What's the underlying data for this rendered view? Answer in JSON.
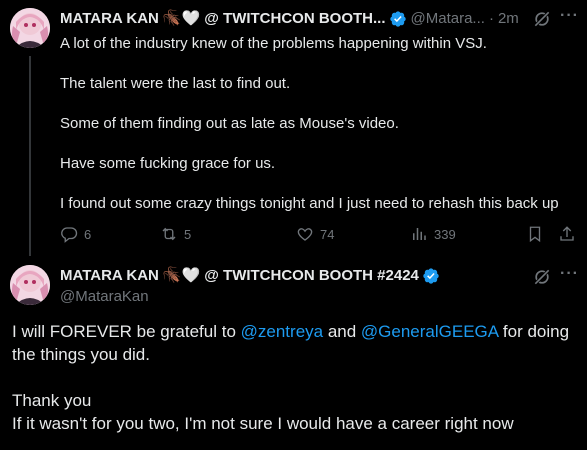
{
  "post1": {
    "display_name": "MATARA KAN",
    "emojis": "🪳🤍",
    "name_suffix": "@ TWITCHCON BOOTH...",
    "handle": "@Matara...",
    "separator": "·",
    "time": "2m",
    "lines": [
      "A lot of the industry knew of the problems happening within VSJ.",
      "The talent were the last to find out.",
      "Some of them finding out as late as Mouse's video.",
      "Have some fucking grace for us.",
      "I found out some crazy things tonight and I just need to rehash this back up"
    ],
    "stats": {
      "replies": "6",
      "reposts": "5",
      "likes": "74",
      "views": "339"
    }
  },
  "post2": {
    "display_name": "MATARA KAN",
    "emojis": "🪳🤍",
    "name_suffix": "@ TWITCHCON BOOTH #2424",
    "handle": "@MataraKan",
    "line1_pre": "I will FOREVER be grateful to ",
    "mention1": "@zentreya",
    "line1_mid": " and ",
    "mention2": "@GeneralGEEGA",
    "line1_post": " for doing the things you did.",
    "line2": "Thank you",
    "line3": "If it wasn't for you two, I'm not sure I would have a career right now"
  },
  "icons": {
    "more": "more-icon",
    "grok": "grok-icon",
    "verified_color": "#1d9bf0"
  },
  "more_glyph": "···"
}
